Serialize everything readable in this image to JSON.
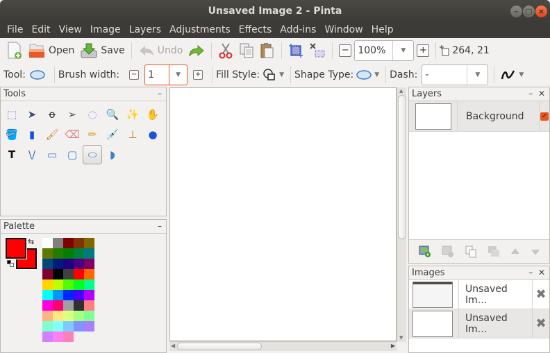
{
  "window": {
    "title": "Unsaved Image 2 - Pinta",
    "controls": [
      "minimize",
      "maximize",
      "close"
    ]
  },
  "menubar": {
    "items": [
      "File",
      "Edit",
      "View",
      "Image",
      "Layers",
      "Adjustments",
      "Effects",
      "Add-ins",
      "Window",
      "Help"
    ]
  },
  "toolbar": {
    "new_icon": "new-image-icon",
    "open_label": "Open",
    "save_label": "Save",
    "undo_label": "Undo",
    "redo_icon": "redo-icon",
    "cut_icon": "cut-icon",
    "copy_icon": "copy-icon",
    "paste_icon": "paste-icon",
    "crop_icon": "crop-to-selection-icon",
    "deselect_icon": "deselect-icon",
    "zoom_out_icon": "zoom-out-icon",
    "zoom_value": "100%",
    "zoom_in_icon": "zoom-in-icon",
    "cursor_position": "264, 21"
  },
  "tool_options": {
    "tool_label": "Tool:",
    "brush_width_label": "Brush width:",
    "brush_width_value": "1",
    "fill_style_label": "Fill Style:",
    "shape_type_label": "Shape Type:",
    "dash_label": "Dash:",
    "dash_value": "-"
  },
  "tools_panel": {
    "title": "Tools",
    "tools": [
      {
        "name": "rectangle-select",
        "glyph": "⬚"
      },
      {
        "name": "move-selected",
        "glyph": "➤"
      },
      {
        "name": "lasso-select",
        "glyph": "ꝋ"
      },
      {
        "name": "move-selection",
        "glyph": "➢"
      },
      {
        "name": "ellipse-select",
        "glyph": "◌"
      },
      {
        "name": "zoom",
        "glyph": "🔍"
      },
      {
        "name": "magic-wand",
        "glyph": "✨"
      },
      {
        "name": "pan",
        "glyph": "✋"
      },
      {
        "name": "paint-bucket",
        "glyph": "🪣"
      },
      {
        "name": "gradient",
        "glyph": "▮"
      },
      {
        "name": "paintbrush",
        "glyph": "🖌"
      },
      {
        "name": "eraser",
        "glyph": "⌫"
      },
      {
        "name": "pencil",
        "glyph": "✏"
      },
      {
        "name": "color-picker",
        "glyph": "💉"
      },
      {
        "name": "clone-stamp",
        "glyph": "⊥"
      },
      {
        "name": "recolor",
        "glyph": "●"
      },
      {
        "name": "text",
        "glyph": "T"
      },
      {
        "name": "line-curve",
        "glyph": "\\/"
      },
      {
        "name": "rectangle",
        "glyph": "▭"
      },
      {
        "name": "rounded-rectangle",
        "glyph": "▢"
      },
      {
        "name": "ellipse",
        "glyph": "⬭"
      },
      {
        "name": "freeform-shape",
        "glyph": "◗"
      }
    ],
    "selected_tool": "ellipse"
  },
  "palette_panel": {
    "title": "Palette",
    "primary_color": "#ff0000",
    "secondary_color": "#ff0000",
    "colors": [
      "#ffffff",
      "#808080",
      "#800000",
      "#803300",
      "#806600",
      "#5c7a00",
      "#267a00",
      "#008000",
      "#008040",
      "#007a7a",
      "#00487a",
      "#001a80",
      "#200080",
      "#4a0080",
      "#800066",
      "#800033",
      "#000000",
      "#404040",
      "#ff0000",
      "#ff6600",
      "#ffd500",
      "#bfff00",
      "#4dff00",
      "#00ff22",
      "#00ff88",
      "#00ffff",
      "#0094ff",
      "#0026ff",
      "#4800ff",
      "#b200ff",
      "#ff00dc",
      "#ff006e",
      "#a0a0a0",
      "#303030",
      "#ff7f7f",
      "#ffb380",
      "#ffe680",
      "#dfff80",
      "#a6ff80",
      "#80ff95",
      "#80ffcc",
      "#80ffff",
      "#80c9ff",
      "#8093ff",
      "#a680ff",
      "#d280ff",
      "#ff80ed",
      "#ff80b6"
    ]
  },
  "layers_panel": {
    "title": "Layers",
    "layers": [
      {
        "name": "Background",
        "visible": true
      }
    ],
    "actions": [
      "add-layer",
      "delete-layer",
      "duplicate-layer",
      "merge-layer-down",
      "move-layer-up",
      "move-layer-down"
    ]
  },
  "images_panel": {
    "title": "Images",
    "images": [
      {
        "name": "Unsaved Im..."
      },
      {
        "name": "Unsaved Im..."
      }
    ]
  },
  "colors": {
    "accent": "#e95420",
    "titlebar": "#3c3b37",
    "panel_bg": "#f2f1f0"
  }
}
